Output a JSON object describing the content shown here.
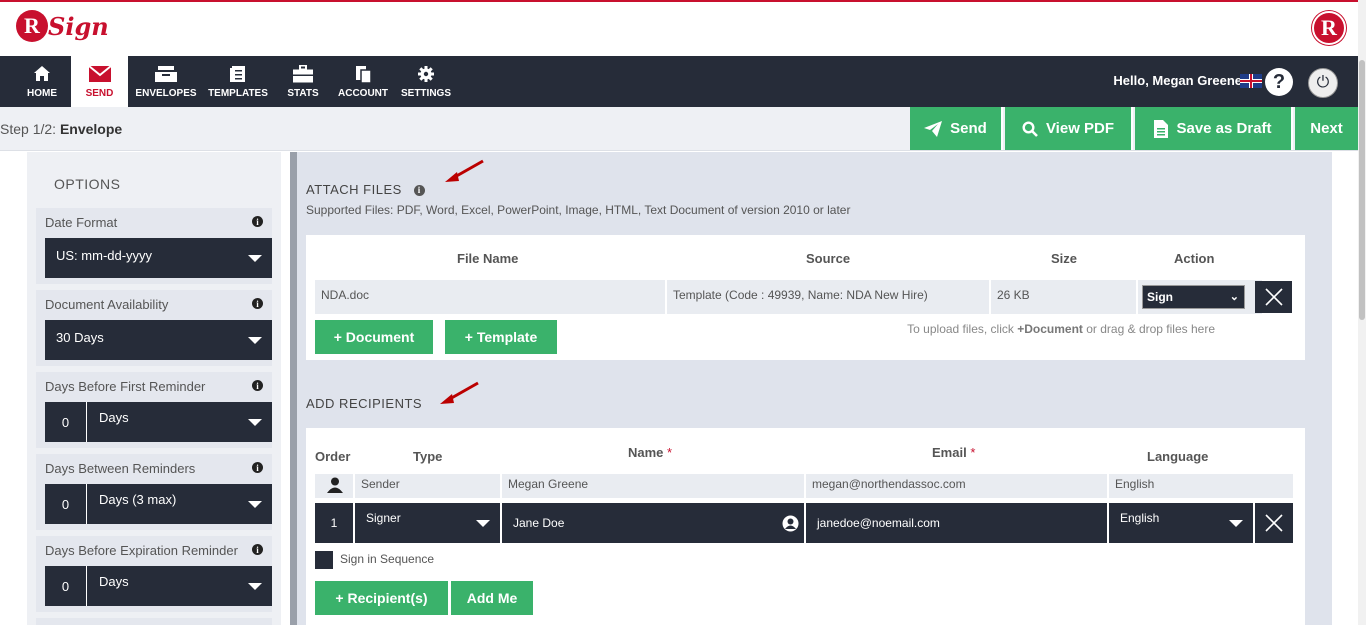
{
  "brand": {
    "logo_letter": "R",
    "logo_text": "Sign",
    "right_logo_letter": "R"
  },
  "nav": {
    "items": [
      {
        "label": "HOME",
        "icon": "home-icon"
      },
      {
        "label": "SEND",
        "icon": "envelope-icon"
      },
      {
        "label": "ENVELOPES",
        "icon": "inbox-icon"
      },
      {
        "label": "TEMPLATES",
        "icon": "templates-icon"
      },
      {
        "label": "STATS",
        "icon": "briefcase-icon"
      },
      {
        "label": "ACCOUNT",
        "icon": "account-icon"
      },
      {
        "label": "SETTINGS",
        "icon": "gear-icon"
      }
    ],
    "active": "SEND",
    "greeting": "Hello, Megan Greene",
    "help_glyph": "?",
    "power_glyph": "⏻"
  },
  "step": {
    "prefix": "Step 1/2:",
    "title": "Envelope"
  },
  "actions": {
    "send": "Send",
    "view_pdf": "View PDF",
    "save_draft": "Save as Draft",
    "next": "Next"
  },
  "options": {
    "title": "OPTIONS",
    "date_format": {
      "label": "Date Format",
      "value": "US: mm-dd-yyyy"
    },
    "doc_availability": {
      "label": "Document Availability",
      "value": "30 Days"
    },
    "first_reminder": {
      "label": "Days Before First Reminder",
      "number": "0",
      "unit": "Days"
    },
    "between_reminders": {
      "label": "Days Between Reminders",
      "number": "0",
      "unit": "Days (3 max)"
    },
    "expiration_reminder": {
      "label": "Days Before Expiration Reminder",
      "number": "0",
      "unit": "Days"
    }
  },
  "attach": {
    "title": "ATTACH FILES",
    "info_glyph": "i",
    "supported": "Supported Files: PDF, Word, Excel, PowerPoint, Image, HTML, Text Document of version 2010 or later",
    "columns": {
      "file_name": "File Name",
      "source": "Source",
      "size": "Size",
      "action": "Action"
    },
    "file": {
      "name": "NDA.doc",
      "source": "Template (Code : 49939, Name: NDA New Hire)",
      "size": "26 KB",
      "action": "Sign"
    },
    "add_document": "+ Document",
    "add_template": "+ Template",
    "hint_prefix": "To upload files, click ",
    "hint_bold": "+Document",
    "hint_suffix": " or drag & drop files here"
  },
  "recipients": {
    "title": "ADD RECIPIENTS",
    "columns": {
      "order": "Order",
      "type": "Type",
      "name": "Name",
      "email": "Email",
      "language": "Language",
      "required_mark": "*"
    },
    "sender": {
      "type": "Sender",
      "name": "Megan Greene",
      "email": "megan@northendassoc.com",
      "language": "English"
    },
    "signer": {
      "order": "1",
      "type": "Signer",
      "name": "Jane Doe",
      "email": "janedoe@noemail.com",
      "language": "English"
    },
    "sign_in_sequence": "Sign in Sequence",
    "add_recipients": "+ Recipient(s)",
    "add_me": "Add Me"
  },
  "colors": {
    "accent_red": "#c8102e",
    "nav_dark": "#262c39",
    "green": "#3ab26b"
  }
}
